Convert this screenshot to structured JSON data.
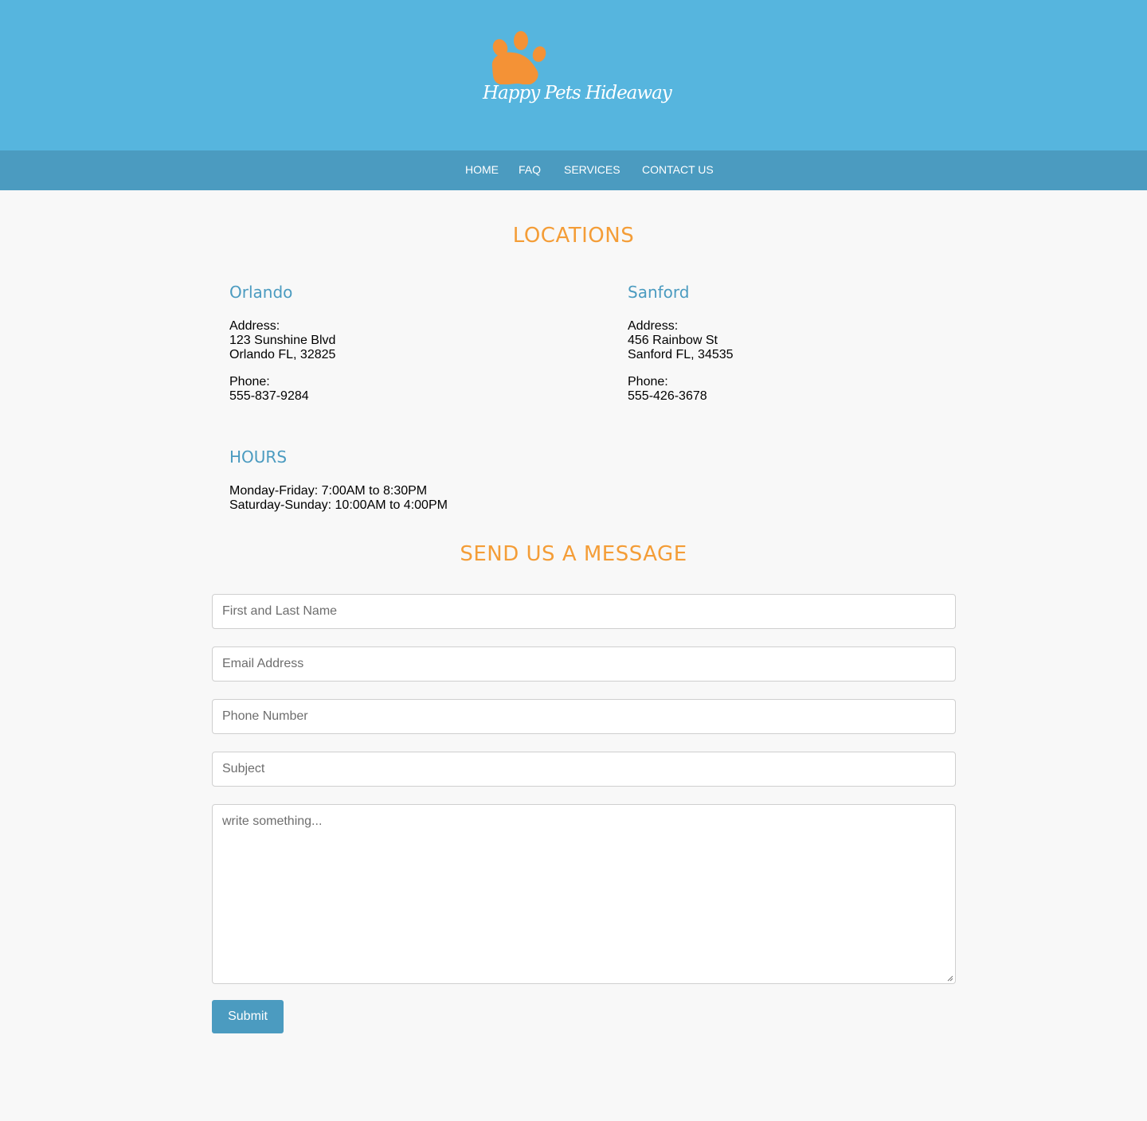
{
  "brand": {
    "logo_text": "Happy Pets Hideaway",
    "colors": {
      "header_bg": "#56b5de",
      "nav_bg": "#4b9bc0",
      "accent_orange": "#f49d37",
      "heading_blue": "#4b9bc0"
    }
  },
  "nav": {
    "items": [
      {
        "label": "HOME"
      },
      {
        "label": "FAQ"
      },
      {
        "label": "SERVICES"
      },
      {
        "label": "CONTACT US"
      }
    ]
  },
  "locations": {
    "title": "LOCATIONS",
    "orlando": {
      "name": "Orlando",
      "address_label": "Address:",
      "street": "123 Sunshine Blvd",
      "city": "Orlando FL, 32825",
      "phone_label": "Phone:",
      "phone": "555-837-9284"
    },
    "sanford": {
      "name": "Sanford",
      "address_label": "Address:",
      "street": "456 Rainbow St",
      "city": "Sanford FL, 34535",
      "phone_label": "Phone:",
      "phone": "555-426-3678"
    }
  },
  "hours": {
    "title": "HOURS",
    "weekday": "Monday-Friday: 7:00AM to 8:30PM",
    "weekend": "Saturday-Sunday: 10:00AM to 4:00PM"
  },
  "contact_form": {
    "title": "SEND US A MESSAGE",
    "name_placeholder": "First and Last Name",
    "email_placeholder": "Email Address",
    "phone_placeholder": "Phone Number",
    "subject_placeholder": "Subject",
    "message_placeholder": "write something...",
    "submit_label": "Submit"
  }
}
